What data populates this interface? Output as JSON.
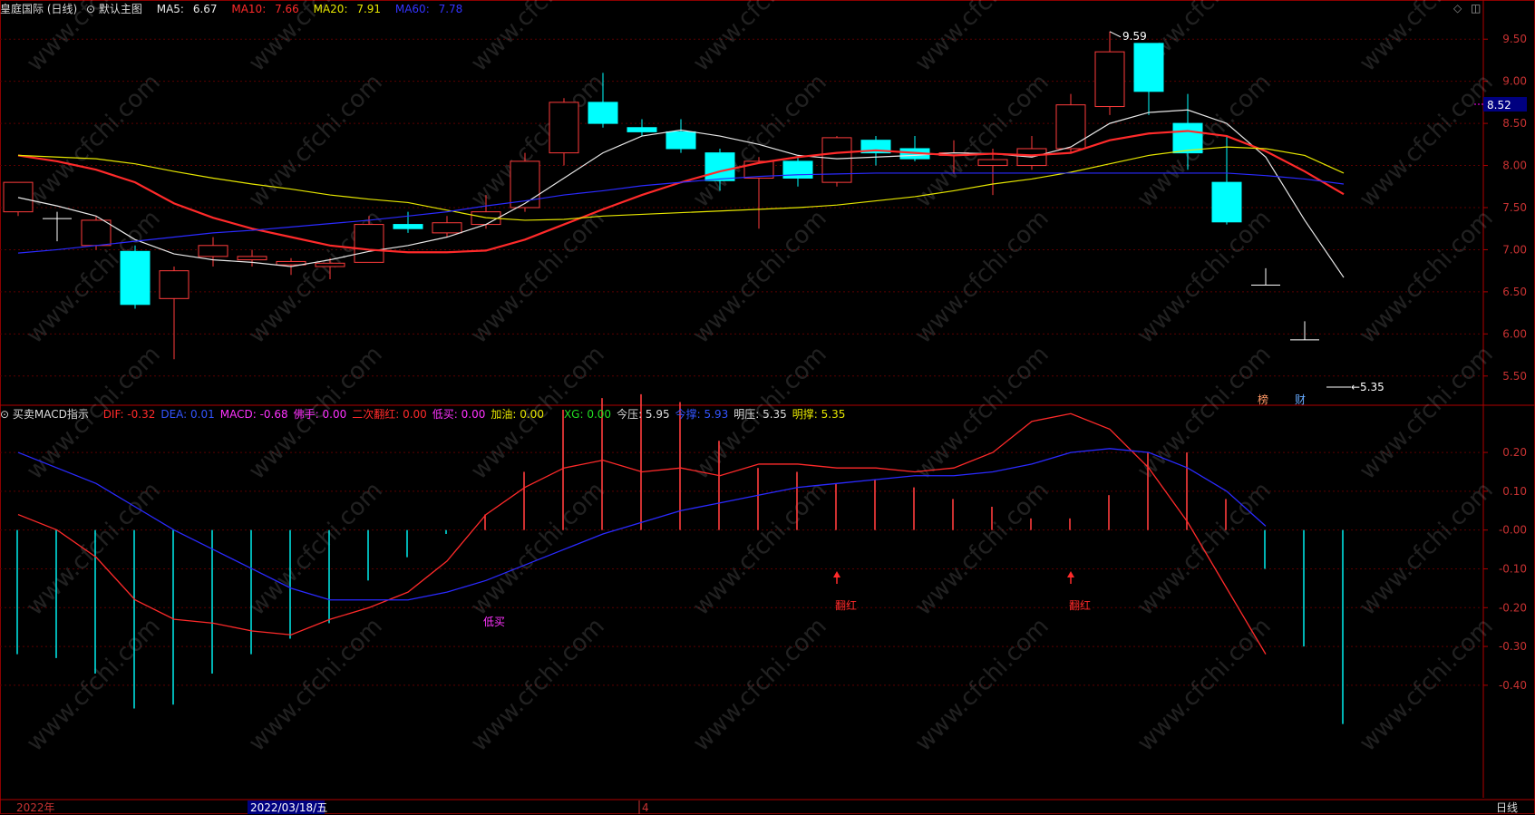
{
  "header": {
    "title": "皇庭国际 (日线)",
    "main_chart_label": "默认主图",
    "ma": [
      {
        "label": "MA5:",
        "value": "6.67",
        "color": "#e8e8e8"
      },
      {
        "label": "MA10:",
        "value": "7.66",
        "color": "#ff2a2a"
      },
      {
        "label": "MA20:",
        "value": "7.91",
        "color": "#e6e600"
      },
      {
        "label": "MA60:",
        "value": "7.78",
        "color": "#3333ff"
      }
    ]
  },
  "indicator": {
    "title": "买卖MACD指示",
    "items": [
      {
        "label": "DIF:",
        "value": "-0.32",
        "color": "#ff2a2a"
      },
      {
        "label": "DEA:",
        "value": "0.01",
        "color": "#3355ff"
      },
      {
        "label": "MACD:",
        "value": "-0.68",
        "color": "#ff33ff"
      },
      {
        "label": "佛手:",
        "value": "0.00",
        "color": "#ff33ff"
      },
      {
        "label": "二次翻红:",
        "value": "0.00",
        "color": "#ff2a2a"
      },
      {
        "label": "低买:",
        "value": "0.00",
        "color": "#ff33ff"
      },
      {
        "label": "加油:",
        "value": "0.00",
        "color": "#e6e600"
      },
      {
        "label": "XG:",
        "value": "0.00",
        "color": "#22dd22"
      },
      {
        "label": "今压:",
        "value": "5.95",
        "color": "#dddddd"
      },
      {
        "label": "今撑:",
        "value": "5.93",
        "color": "#3355ff"
      },
      {
        "label": "明压:",
        "value": "5.35",
        "color": "#dddddd"
      },
      {
        "label": "明撑:",
        "value": "5.35",
        "color": "#e6e600"
      }
    ]
  },
  "annotations": {
    "high_label": "9.59",
    "low_label": "5.35",
    "current_price": "8.52",
    "tag1": "榜",
    "tag2": "财",
    "macd_low_buy": "低买",
    "macd_red1": "翻红",
    "macd_red2": "翻红"
  },
  "bottom_bar": {
    "year": "2022年",
    "date": "2022/03/18/五",
    "month": "4",
    "period": "日线"
  },
  "watermark": "www.cfchi.com",
  "chart_data": [
    {
      "type": "candlestick",
      "ylim": [
        5.25,
        9.75
      ],
      "ticks": [
        "9.50",
        "9.00",
        "8.50",
        "8.00",
        "7.50",
        "7.00",
        "6.50",
        "6.00",
        "5.50"
      ],
      "candles": [
        {
          "o": 7.45,
          "h": 7.6,
          "l": 7.4,
          "c": 7.8
        },
        {
          "o": 7.37,
          "h": 7.45,
          "l": 7.1,
          "c": 7.37
        },
        {
          "o": 7.05,
          "h": 7.4,
          "l": 7.0,
          "c": 7.35
        },
        {
          "o": 6.98,
          "h": 7.05,
          "l": 6.3,
          "c": 6.35
        },
        {
          "o": 6.42,
          "h": 6.8,
          "l": 5.7,
          "c": 6.75
        },
        {
          "o": 6.92,
          "h": 7.15,
          "l": 6.8,
          "c": 7.05
        },
        {
          "o": 6.88,
          "h": 7.0,
          "l": 6.8,
          "c": 6.92
        },
        {
          "o": 6.82,
          "h": 6.9,
          "l": 6.7,
          "c": 6.86
        },
        {
          "o": 6.8,
          "h": 6.9,
          "l": 6.65,
          "c": 6.84
        },
        {
          "o": 6.85,
          "h": 7.4,
          "l": 6.85,
          "c": 7.3
        },
        {
          "o": 7.3,
          "h": 7.45,
          "l": 7.2,
          "c": 7.25
        },
        {
          "o": 7.2,
          "h": 7.4,
          "l": 7.15,
          "c": 7.32
        },
        {
          "o": 7.3,
          "h": 7.65,
          "l": 7.25,
          "c": 7.45
        },
        {
          "o": 7.5,
          "h": 8.15,
          "l": 7.45,
          "c": 8.05
        },
        {
          "o": 8.15,
          "h": 8.8,
          "l": 8.0,
          "c": 8.75
        },
        {
          "o": 8.75,
          "h": 9.1,
          "l": 8.45,
          "c": 8.5
        },
        {
          "o": 8.45,
          "h": 8.55,
          "l": 8.35,
          "c": 8.4
        },
        {
          "o": 8.4,
          "h": 8.55,
          "l": 8.15,
          "c": 8.2
        },
        {
          "o": 8.15,
          "h": 8.2,
          "l": 7.7,
          "c": 7.82
        },
        {
          "o": 7.85,
          "h": 8.1,
          "l": 7.25,
          "c": 8.05
        },
        {
          "o": 8.05,
          "h": 8.1,
          "l": 7.75,
          "c": 7.85
        },
        {
          "o": 7.8,
          "h": 8.35,
          "l": 7.75,
          "c": 8.33
        },
        {
          "o": 8.3,
          "h": 8.35,
          "l": 8.0,
          "c": 8.15
        },
        {
          "o": 8.2,
          "h": 8.35,
          "l": 8.05,
          "c": 8.08
        },
        {
          "o": 8.12,
          "h": 8.3,
          "l": 7.9,
          "c": 8.15
        },
        {
          "o": 8.0,
          "h": 8.2,
          "l": 7.65,
          "c": 8.07
        },
        {
          "o": 8.0,
          "h": 8.35,
          "l": 7.95,
          "c": 8.2
        },
        {
          "o": 8.2,
          "h": 8.85,
          "l": 8.15,
          "c": 8.72
        },
        {
          "o": 8.7,
          "h": 9.59,
          "l": 8.6,
          "c": 9.35
        },
        {
          "o": 9.45,
          "h": 9.45,
          "l": 8.6,
          "c": 8.88
        },
        {
          "o": 8.5,
          "h": 8.85,
          "l": 7.95,
          "c": 8.15
        },
        {
          "o": 7.8,
          "h": 8.35,
          "l": 7.3,
          "c": 7.33
        },
        {
          "o": 6.58,
          "h": 6.78,
          "l": 6.58,
          "c": 6.58
        },
        {
          "o": 5.93,
          "h": 6.15,
          "l": 5.93,
          "c": 5.93
        }
      ],
      "series": [
        {
          "name": "MA5",
          "color": "#e8e8e8",
          "values": [
            7.62,
            7.52,
            7.4,
            7.12,
            6.95,
            6.88,
            6.85,
            6.8,
            6.88,
            6.98,
            7.05,
            7.15,
            7.3,
            7.55,
            7.85,
            8.15,
            8.35,
            8.42,
            8.35,
            8.25,
            8.12,
            8.08,
            8.1,
            8.12,
            8.15,
            8.14,
            8.1,
            8.22,
            8.5,
            8.63,
            8.66,
            8.5,
            8.1,
            7.35,
            6.67
          ]
        },
        {
          "name": "MA10",
          "color": "#ff2a2a",
          "values": [
            8.12,
            8.05,
            7.95,
            7.8,
            7.55,
            7.38,
            7.25,
            7.15,
            7.05,
            7.0,
            6.97,
            6.97,
            6.99,
            7.12,
            7.3,
            7.48,
            7.65,
            7.8,
            7.93,
            8.03,
            8.1,
            8.15,
            8.18,
            8.15,
            8.12,
            8.14,
            8.12,
            8.15,
            8.3,
            8.38,
            8.41,
            8.35,
            8.17,
            7.93,
            7.66
          ]
        },
        {
          "name": "MA20",
          "color": "#e6e600",
          "values": [
            8.12,
            8.1,
            8.08,
            8.02,
            7.93,
            7.85,
            7.78,
            7.72,
            7.65,
            7.6,
            7.56,
            7.47,
            7.38,
            7.35,
            7.36,
            7.4,
            7.42,
            7.44,
            7.46,
            7.48,
            7.5,
            7.53,
            7.58,
            7.63,
            7.7,
            7.78,
            7.84,
            7.92,
            8.02,
            8.12,
            8.18,
            8.22,
            8.2,
            8.12,
            7.91
          ]
        },
        {
          "name": "MA60",
          "color": "#2a2aff",
          "values": [
            6.96,
            7.0,
            7.05,
            7.1,
            7.15,
            7.2,
            7.23,
            7.27,
            7.31,
            7.35,
            7.4,
            7.45,
            7.52,
            7.58,
            7.65,
            7.7,
            7.76,
            7.8,
            7.84,
            7.87,
            7.89,
            7.9,
            7.91,
            7.91,
            7.91,
            7.91,
            7.91,
            7.91,
            7.91,
            7.91,
            7.91,
            7.91,
            7.88,
            7.84,
            7.78
          ]
        }
      ]
    },
    {
      "type": "macd",
      "ylim": [
        -0.69,
        0.31
      ],
      "ticks": [
        "0.20",
        "0.10",
        "-0.00",
        "-0.10",
        "-0.20",
        "-0.30",
        "-0.40"
      ],
      "macd": [
        -0.32,
        -0.33,
        -0.37,
        -0.46,
        -0.45,
        -0.37,
        -0.32,
        -0.28,
        -0.24,
        -0.13,
        -0.07,
        -0.01,
        0.04,
        0.15,
        0.31,
        0.34,
        0.35,
        0.33,
        0.23,
        0.16,
        0.15,
        0.12,
        0.13,
        0.11,
        0.08,
        0.06,
        0.03,
        0.03,
        0.09,
        0.2,
        0.2,
        0.08,
        -0.1,
        -0.3,
        -0.5,
        -0.68
      ],
      "dif": [
        0.04,
        0.0,
        -0.07,
        -0.18,
        -0.23,
        -0.24,
        -0.26,
        -0.27,
        -0.23,
        -0.2,
        -0.16,
        -0.08,
        0.04,
        0.11,
        0.16,
        0.18,
        0.15,
        0.16,
        0.14,
        0.17,
        0.17,
        0.16,
        0.16,
        0.15,
        0.16,
        0.2,
        0.28,
        0.3,
        0.26,
        0.16,
        0.02,
        -0.15,
        -0.32
      ],
      "dea": [
        0.2,
        0.16,
        0.12,
        0.06,
        0.0,
        -0.05,
        -0.1,
        -0.15,
        -0.18,
        -0.18,
        -0.18,
        -0.16,
        -0.13,
        -0.09,
        -0.05,
        -0.01,
        0.02,
        0.05,
        0.07,
        0.09,
        0.11,
        0.12,
        0.13,
        0.14,
        0.14,
        0.15,
        0.17,
        0.2,
        0.21,
        0.2,
        0.16,
        0.1,
        0.01
      ]
    }
  ]
}
